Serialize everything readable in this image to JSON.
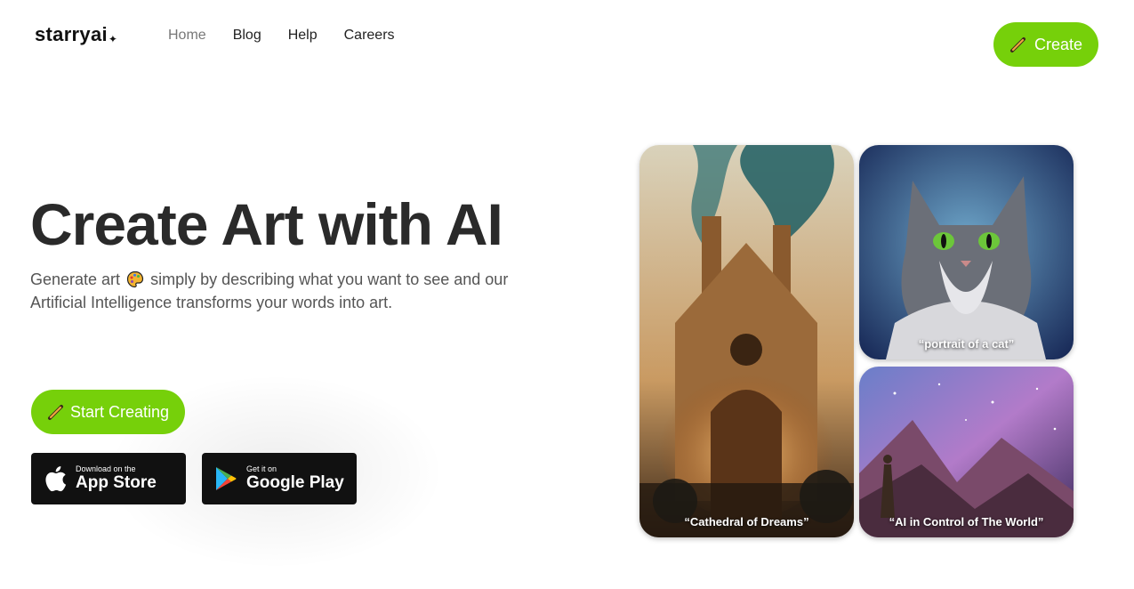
{
  "brand": {
    "logo": "starryai",
    "logo_mark": "✦"
  },
  "nav": {
    "items": [
      "Home",
      "Blog",
      "Help",
      "Careers"
    ],
    "active": "Home"
  },
  "header": {
    "create_label": "Create"
  },
  "hero": {
    "title": "Create Art with AI",
    "subtitle_part1": "Generate art",
    "subtitle_part2": "simply by describing what you want to see and our Artificial Intelligence transforms your words into art.",
    "start_label": "Start Creating"
  },
  "stores": {
    "apple": {
      "small": "Download on the",
      "big": "App Store"
    },
    "google": {
      "small": "Get it on",
      "big": "Google Play"
    }
  },
  "gallery": [
    {
      "caption": "“Cathedral of Dreams”"
    },
    {
      "caption": "“portrait of a cat”"
    },
    {
      "caption": "“AI in Control of The World”"
    }
  ],
  "colors": {
    "accent": "#76d00a",
    "dark": "#111111"
  }
}
